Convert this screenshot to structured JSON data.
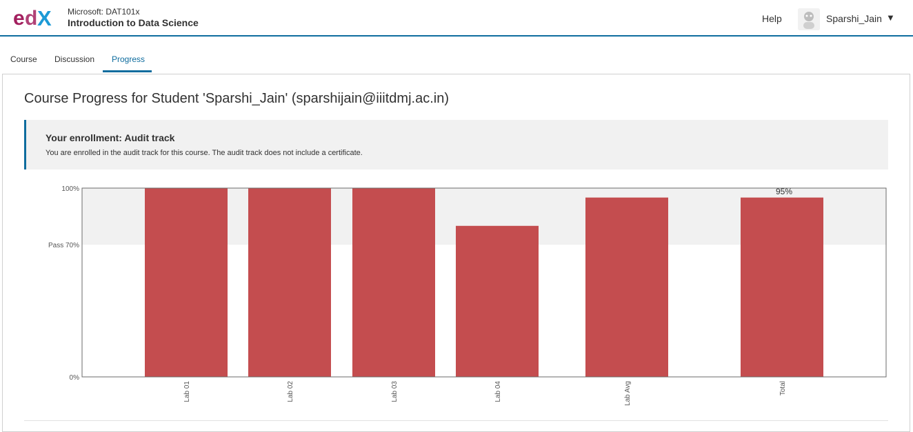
{
  "header": {
    "course_org": "Microsoft: DAT101x",
    "course_name": "Introduction to Data Science",
    "help": "Help",
    "username": "Sparshi_Jain"
  },
  "tabs": [
    {
      "label": "Course"
    },
    {
      "label": "Discussion"
    },
    {
      "label": "Progress"
    }
  ],
  "main": {
    "title": "Course Progress for Student 'Sparshi_Jain' (sparshijain@iiitdmj.ac.in)",
    "enrollment_title": "Your enrollment: Audit track",
    "enrollment_msg": "You are enrolled in the audit track for this course. The audit track does not include a certificate."
  },
  "colors": {
    "accent": "#0e6c9e",
    "bar": "#c44d4f",
    "pass_band": "#f1f1f1"
  },
  "chart_data": {
    "type": "bar",
    "categories": [
      "Lab 01",
      "Lab 02",
      "Lab 03",
      "Lab 04",
      "Lab Avg",
      "Total"
    ],
    "values": [
      100,
      100,
      100,
      80,
      95,
      95
    ],
    "ylim": [
      0,
      100
    ],
    "yticks": [
      {
        "value": 100,
        "label": "100%"
      },
      {
        "value": 70,
        "label": "Pass 70%"
      },
      {
        "value": 0,
        "label": "0%"
      }
    ],
    "total_label": "95%",
    "pass_threshold": 70
  }
}
